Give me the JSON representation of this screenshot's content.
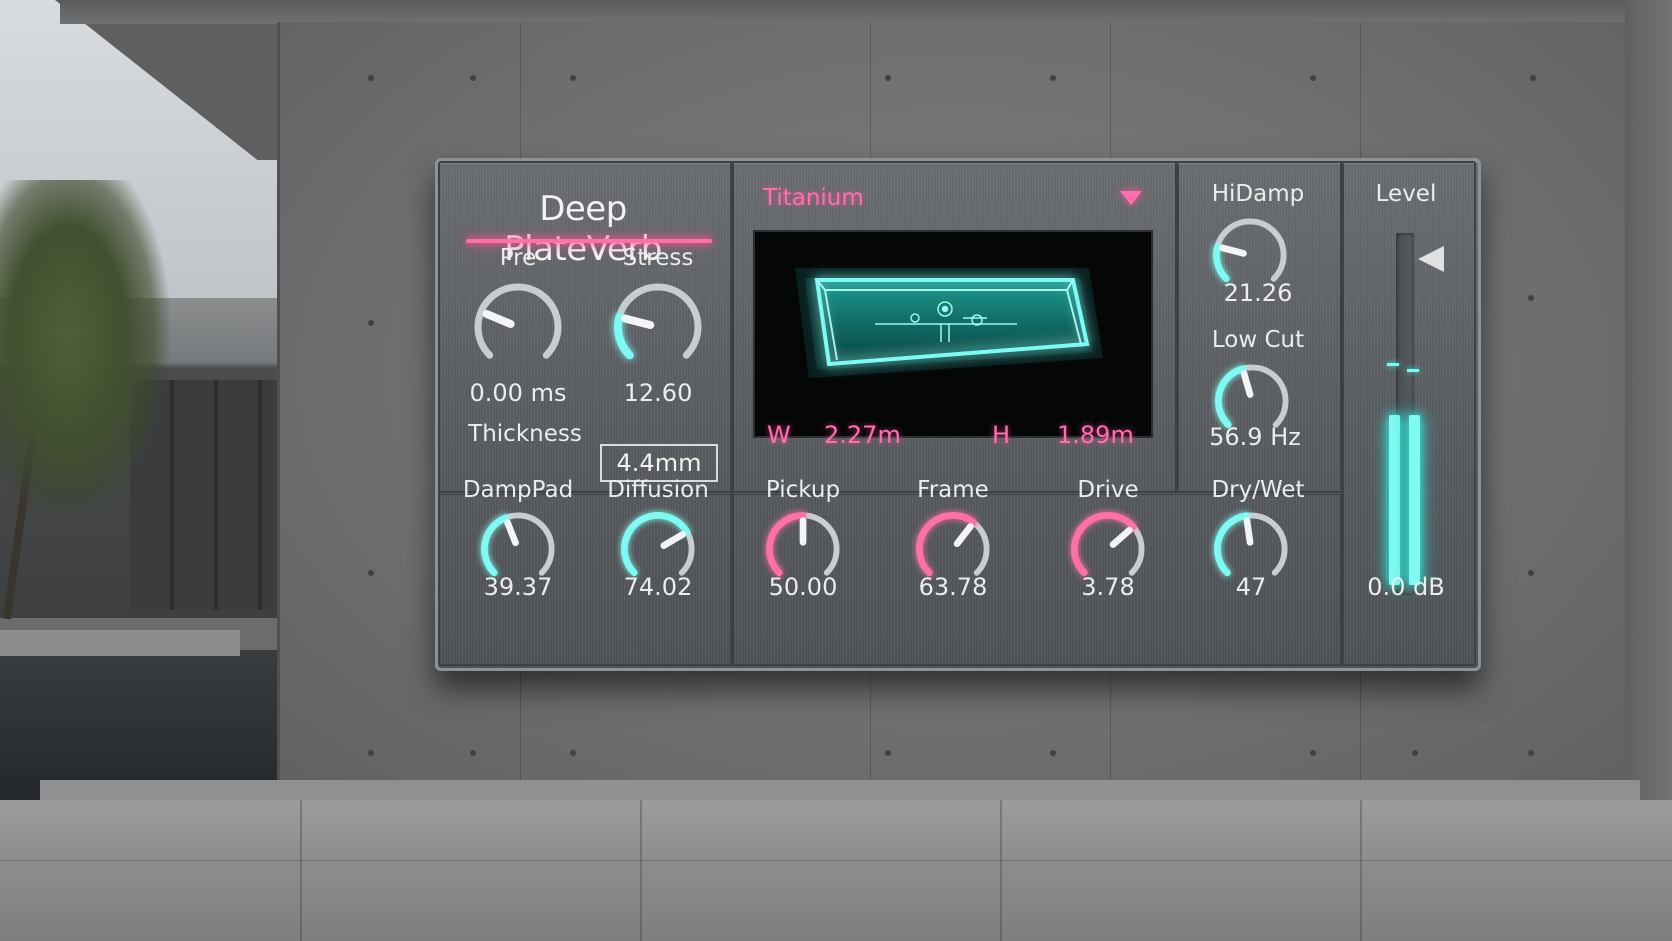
{
  "plugin": {
    "title": "Deep PlateVerb",
    "preset": {
      "name": "Titanium"
    },
    "controls": {
      "pre": {
        "label": "Pre",
        "value": "0.00 ms",
        "level": 0.25
      },
      "stress": {
        "label": "Stress",
        "value": "12.60",
        "level": 0.22
      },
      "thickness": {
        "label": "Thickness",
        "value": "4.4mm"
      },
      "damppad": {
        "label": "DampPad",
        "value": "39.37",
        "level": 0.42
      },
      "diffusion": {
        "label": "Diffusion",
        "value": "74.02",
        "level": 0.72
      },
      "pickup": {
        "label": "Pickup",
        "value": "50.00",
        "level": 0.5
      },
      "frame": {
        "label": "Frame",
        "value": "63.78",
        "level": 0.64
      },
      "drive": {
        "label": "Drive",
        "value": "3.78",
        "level": 0.68
      },
      "hidamp": {
        "label": "HiDamp",
        "value": "21.26",
        "level": 0.22
      },
      "lowcut": {
        "label": "Low Cut",
        "value": "56.9 Hz",
        "level": 0.44
      },
      "drywet": {
        "label": "Dry/Wet",
        "value": "47",
        "level": 0.47
      }
    },
    "dimensions": {
      "w_label": "W",
      "w_value": "2.27m",
      "h_label": "H",
      "h_value": "1.89m"
    },
    "level": {
      "label": "Level",
      "value": "0.0 dB",
      "meter_left": 0.47,
      "meter_right": 0.47,
      "peak": 0.64
    },
    "colors": {
      "accent_pink": "#ff6fa8",
      "accent_cyan": "#7ffaf2",
      "knob_track": "#c9ccd0"
    }
  }
}
